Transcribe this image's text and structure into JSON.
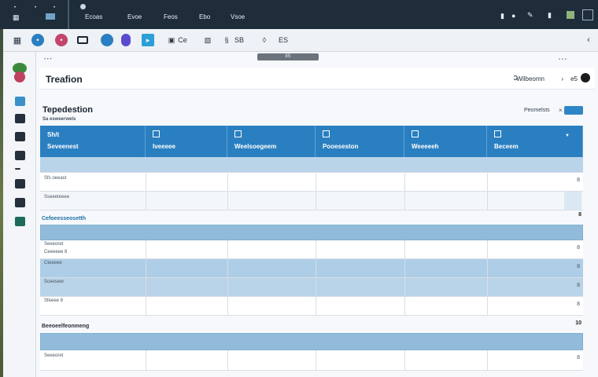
{
  "topbar": {
    "menu": [
      "Ecoas",
      "Evoe",
      "Feos",
      "Ebo",
      "Vsoe"
    ]
  },
  "colors": {
    "topbar": "#1f2c3a",
    "accent": "#2a7fc0",
    "band": "#92bbd9",
    "row_highlight": "#b9d3e8"
  },
  "toolbar": {
    "labels": [
      "Ce",
      "SB",
      "ES"
    ]
  },
  "main": {
    "handle_label": "8S",
    "app_title": "Treafion",
    "user_name": "Wilbeomn",
    "user_code": "e5",
    "page_title": "Tepedestion",
    "page_subtitle": "Sa esweerwels",
    "view_link": "Peomelsts",
    "columns": [
      "Seveenest",
      "Iveeeee",
      "Weelsoegeem",
      "Pooeseston",
      "Weeeeeh",
      "Beceem"
    ],
    "column_top": [
      "Sh/t",
      "",
      "",
      "",
      "",
      ""
    ],
    "group1_label": "Cefoeesseosetth",
    "group2_label": "Beeoeelfeonmeng",
    "group1_count": "8",
    "group2_count": "10",
    "row_labels": {
      "r1": "Sfs oeeast",
      "r2": "Sseeeteeee",
      "r3": "Seeeoret",
      "r4": "Ceeeeee 8",
      "r5": "Cteeeee",
      "r6": "Sceeseer",
      "r7": "Sfeeee 8"
    },
    "row_ends": [
      "8",
      "8",
      "8",
      "8",
      "8",
      "8",
      "8"
    ]
  }
}
